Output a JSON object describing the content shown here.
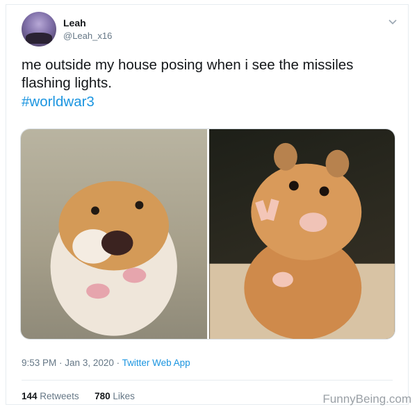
{
  "user": {
    "name": "Leah",
    "handle": "@Leah_x16"
  },
  "tweet": {
    "text": "me outside my house posing when i see the missiles flashing lights.",
    "hashtag": "#worldwar3",
    "time": "9:53 PM",
    "date": "Jan 3, 2020",
    "source": "Twitter Web App",
    "retweet_count": "144",
    "retweet_label": "Retweets",
    "like_count": "780",
    "like_label": "Likes"
  },
  "watermark": "FunnyBeing.com",
  "icons": {
    "menu": "chevron-down-icon"
  }
}
